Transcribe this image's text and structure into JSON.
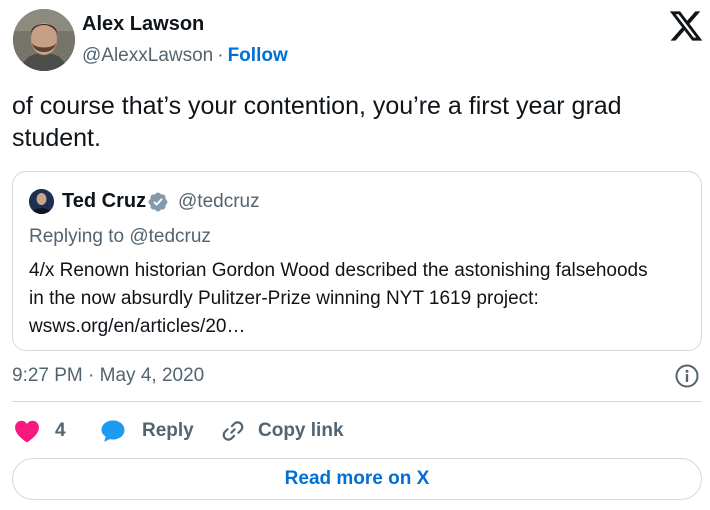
{
  "author": {
    "name": "Alex Lawson",
    "handle": "@AlexxLawson",
    "separator": "·",
    "follow_label": "Follow"
  },
  "header": {
    "logo_icon": "x-logo-icon"
  },
  "tweet": {
    "text": "of course that’s your contention, you’re a first year grad student."
  },
  "quoted_tweet": {
    "name": "Ted Cruz",
    "verified_icon": "verified-badge-icon",
    "handle": "@tedcruz",
    "replying_to": "Replying to @tedcruz",
    "text_lines": [
      "4/x Renown historian Gordon Wood described the astonishing falsehoods",
      "in the now absurdly Pulitzer-Prize winning NYT 1619 project:",
      "wsws.org/en/articles/20…"
    ]
  },
  "meta": {
    "timestamp": "9:27 PM · May 4, 2020",
    "info_icon": "info-icon"
  },
  "actions": {
    "like_icon": "heart-icon",
    "like_count": "4",
    "reply_icon": "speech-bubble-icon",
    "reply_label": "Reply",
    "copy_icon": "link-icon",
    "copy_label": "Copy link"
  },
  "footer": {
    "read_more_label": "Read more on X"
  },
  "colors": {
    "accent": "#006fd6",
    "like": "#f91880",
    "reply": "#1d9bf0",
    "secondary_text": "#536471",
    "border": "#cfd9de"
  }
}
